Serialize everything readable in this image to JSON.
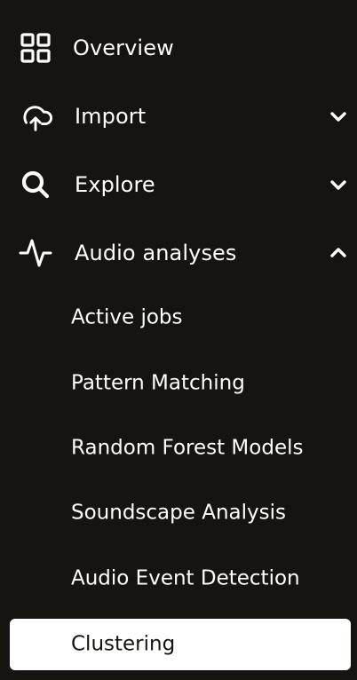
{
  "nav": {
    "items": [
      {
        "label": "Overview",
        "icon": "grid-icon"
      },
      {
        "label": "Import",
        "icon": "cloud-upload-icon",
        "chevron": "chevron-down-icon"
      },
      {
        "label": "Explore",
        "icon": "search-icon",
        "chevron": "chevron-down-icon"
      },
      {
        "label": "Audio analyses",
        "icon": "activity-icon",
        "chevron": "chevron-up-icon"
      }
    ],
    "subitems": [
      {
        "label": "Active jobs"
      },
      {
        "label": "Pattern Matching"
      },
      {
        "label": "Random Forest Models"
      },
      {
        "label": "Soundscape Analysis"
      },
      {
        "label": "Audio Event Detection"
      },
      {
        "label": "Clustering",
        "active": true
      }
    ]
  },
  "colors": {
    "background": "#151410",
    "text": "#ffffff",
    "active_background": "#ffffff",
    "active_text": "#151410"
  }
}
